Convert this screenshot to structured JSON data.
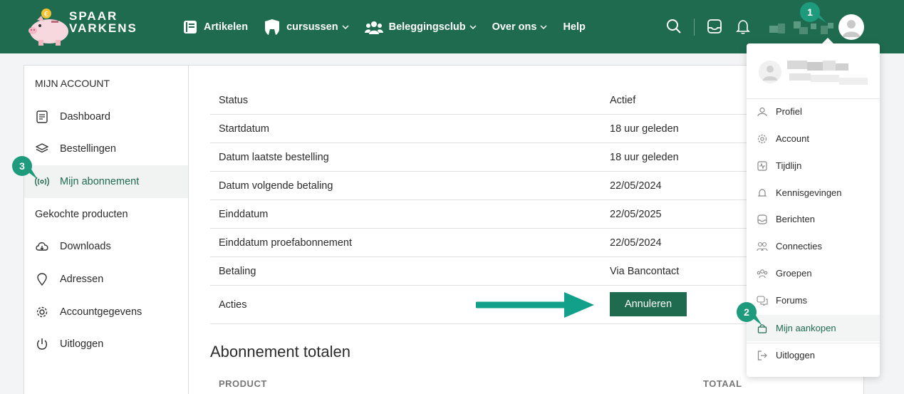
{
  "header": {
    "logo_top": "SPAAR",
    "logo_bottom": "VARKENS",
    "nav": [
      {
        "label": "Artikelen",
        "dropdown": false
      },
      {
        "label": "cursussen",
        "dropdown": true
      },
      {
        "label": "Beleggingsclub",
        "dropdown": true
      },
      {
        "label": "Over ons",
        "dropdown": true
      },
      {
        "label": "Help",
        "dropdown": false
      }
    ]
  },
  "sidebar": {
    "title": "MIJN ACCOUNT",
    "items": [
      {
        "label": "Dashboard",
        "icon": "dashboard-icon"
      },
      {
        "label": "Bestellingen",
        "icon": "layers-icon"
      },
      {
        "label": "Mijn abonnement",
        "icon": "broadcast-icon",
        "active": true
      },
      {
        "label": "Gekochte producten",
        "icon": ""
      },
      {
        "label": "Downloads",
        "icon": "cloud-download-icon"
      },
      {
        "label": "Adressen",
        "icon": "location-pin-icon"
      },
      {
        "label": "Accountgegevens",
        "icon": "gear-icon"
      },
      {
        "label": "Uitloggen",
        "icon": "power-icon"
      }
    ]
  },
  "subscription": {
    "rows": [
      {
        "key": "Status",
        "value": "Actief"
      },
      {
        "key": "Startdatum",
        "value": "18 uur geleden"
      },
      {
        "key": "Datum laatste bestelling",
        "value": "18 uur geleden"
      },
      {
        "key": "Datum volgende betaling",
        "value": "22/05/2024"
      },
      {
        "key": "Einddatum",
        "value": "22/05/2025"
      },
      {
        "key": "Einddatum proefabonnement",
        "value": "22/05/2024"
      },
      {
        "key": "Betaling",
        "value": "Via Bancontact"
      }
    ],
    "actions_label": "Acties",
    "cancel_label": "Annuleren"
  },
  "totals": {
    "title": "Abonnement totalen",
    "col_product": "PRODUCT",
    "col_total": "TOTAAL"
  },
  "dropdown": {
    "items": [
      {
        "label": "Profiel",
        "icon": "user-icon"
      },
      {
        "label": "Account",
        "icon": "gear-icon"
      },
      {
        "label": "Tijdlijn",
        "icon": "timeline-icon"
      },
      {
        "label": "Kennisgevingen",
        "icon": "bell-icon"
      },
      {
        "label": "Berichten",
        "icon": "inbox-icon"
      },
      {
        "label": "Connecties",
        "icon": "connections-icon"
      },
      {
        "label": "Groepen",
        "icon": "groups-icon"
      },
      {
        "label": "Forums",
        "icon": "forum-icon"
      },
      {
        "label": "Mijn aankopen",
        "icon": "shopping-bag-icon",
        "active": true
      },
      {
        "label": "Uitloggen",
        "icon": "logout-icon"
      }
    ]
  },
  "badges": [
    "1",
    "2",
    "3"
  ],
  "colors": {
    "brand": "#1e6b50",
    "badge": "#1e9a7c",
    "arrow": "#13a08a"
  }
}
